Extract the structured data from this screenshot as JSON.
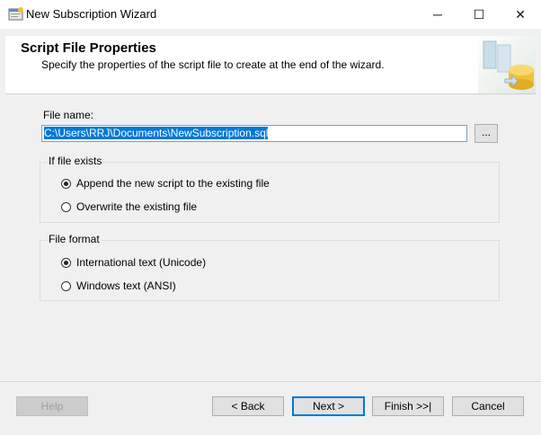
{
  "window": {
    "title": "New Subscription Wizard",
    "minimize": "─",
    "maximize": "☐",
    "close": "✕"
  },
  "header": {
    "title": "Script File Properties",
    "subtitle": "Specify the properties of the script file to create at the end of the wizard."
  },
  "file": {
    "label": "File name:",
    "value": "C:\\Users\\RRJ\\Documents\\NewSubscription.sql",
    "browse_label": "..."
  },
  "if_exists": {
    "legend": "If file exists",
    "options": [
      {
        "label": "Append the new script to the existing file",
        "checked": true
      },
      {
        "label": "Overwrite the existing file",
        "checked": false
      }
    ]
  },
  "file_format": {
    "legend": "File format",
    "options": [
      {
        "label": "International text (Unicode)",
        "checked": true
      },
      {
        "label": "Windows text (ANSI)",
        "checked": false
      }
    ]
  },
  "buttons": {
    "help": "Help",
    "back": "< Back",
    "next": "Next >",
    "finish": "Finish >>|",
    "cancel": "Cancel"
  }
}
